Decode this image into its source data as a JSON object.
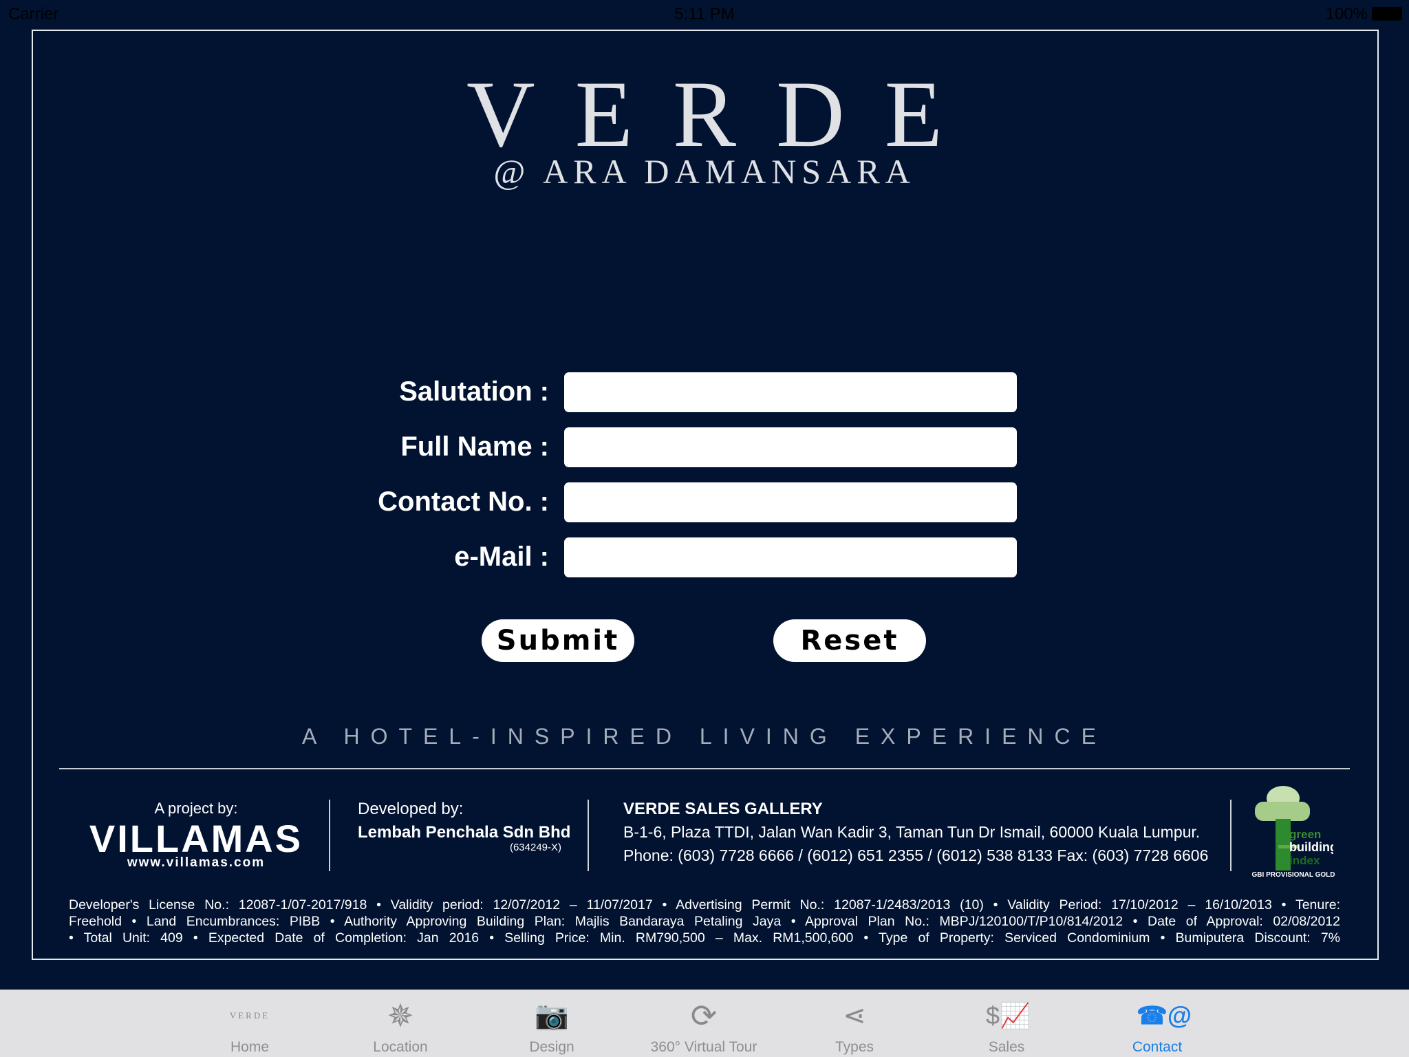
{
  "status_bar": {
    "carrier": "Carrier",
    "time": "5:11 PM",
    "battery": "100%"
  },
  "header": {
    "title": "VERDE",
    "subtitle": "@ ARA DAMANSARA"
  },
  "form": {
    "fields": [
      {
        "label": "Salutation :",
        "value": ""
      },
      {
        "label": "Full Name :",
        "value": ""
      },
      {
        "label": "Contact No. :",
        "value": ""
      },
      {
        "label": "e-Mail :",
        "value": ""
      }
    ],
    "submit": "Submit",
    "reset": "Reset"
  },
  "tagline": "A HOTEL-INSPIRED LIVING EXPERIENCE",
  "footer": {
    "project_by": "A project by:",
    "brand": "VILLAMAS",
    "brand_url": "www.villamas.com",
    "developed_by": "Developed by:",
    "developer": "Lembah Penchala Sdn Bhd",
    "developer_reg": "(634249-X)",
    "gallery_title": "VERDE SALES GALLERY",
    "gallery_address": "B-1-6, Plaza TTDI, Jalan Wan Kadir 3, Taman Tun Dr Ismail, 60000 Kuala Lumpur.",
    "gallery_phone": "Phone: (603) 7728 6666 / (6012) 651 2355 / (6012) 538 8133 Fax: (603) 7728 6606",
    "gbi_logo_text": "green building index",
    "gbi_caption": "GBI PROVISIONAL GOLD",
    "fine_print": [
      "Developer's License No.: 12087-1/07-2017/918 • Validity period: 12/07/2012 – 11/07/2017 • Advertising Permit No.: 12087-1/2483/2013 (10) • Validity Period: 17/10/2012 – 16/10/2013 • Tenure:",
      "Freehold • Land Encumbrances: PIBB • Authority Approving Building Plan: Majlis Bandaraya Petaling Jaya • Approval Plan No.: MBPJ/120100/T/P10/814/2012 • Date of Approval: 02/08/2012",
      "• Total Unit: 409 • Expected Date of Completion: Jan 2016 • Selling Price: Min. RM790,500 – Max. RM1,500,600 • Type of Property: Serviced Condominium • Bumiputera Discount: 7%"
    ]
  },
  "tabs": [
    {
      "label": "Home",
      "icon": "verde-logo-icon",
      "logo_text": "VERDE"
    },
    {
      "label": "Location",
      "icon": "compass-icon"
    },
    {
      "label": "Design",
      "icon": "camera-icon"
    },
    {
      "label": "360° Virtual Tour",
      "icon": "virtual-tour-icon"
    },
    {
      "label": "Types",
      "icon": "share-icon"
    },
    {
      "label": "Sales",
      "icon": "sales-chart-icon"
    },
    {
      "label": "Contact",
      "icon": "contact-icon"
    }
  ],
  "colors": {
    "background": "#011331",
    "active_tab": "#1a7fe8",
    "tab_bar": "#e1e1e3"
  }
}
